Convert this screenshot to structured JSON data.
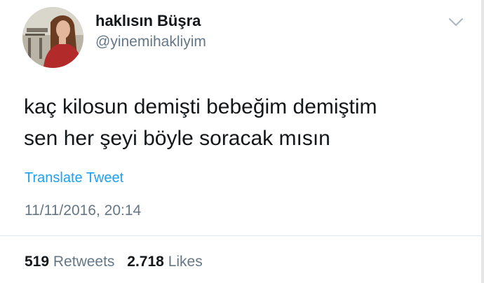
{
  "user": {
    "display_name": "haklısın Büşra",
    "handle": "@yinemihakliyim"
  },
  "tweet": {
    "text_lines": [
      "kaç kilosun demişti bebeğim demiştim",
      "sen her şeyi böyle soracak mısın"
    ],
    "translate_label": "Translate Tweet",
    "timestamp": "11/11/2016, 20:14"
  },
  "stats": {
    "retweets_count": "519",
    "retweets_label": "Retweets",
    "likes_count": "2.718",
    "likes_label": "Likes"
  },
  "icons": {
    "menu": "chevron-down-icon"
  },
  "colors": {
    "link": "#1da1f2",
    "secondary_text": "#657786",
    "primary_text": "#14171a",
    "divider": "#e1e8ed"
  }
}
